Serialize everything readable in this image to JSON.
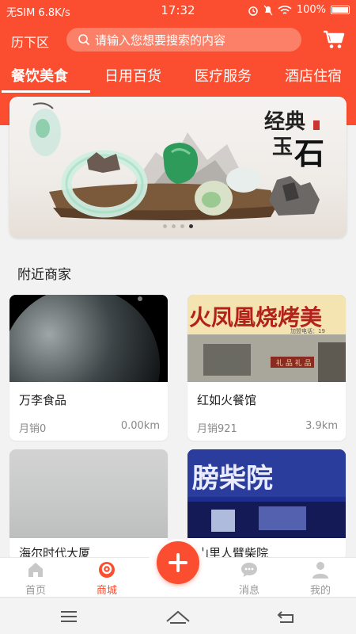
{
  "status_bar": {
    "carrier": "无SIM 6.8K/s",
    "time": "17:32",
    "battery": "100%"
  },
  "header": {
    "location": "历下区",
    "search_placeholder": "请输入您想要搜索的内容"
  },
  "tabs": [
    {
      "label": "餐饮美食",
      "active": true
    },
    {
      "label": "日用百货",
      "active": false
    },
    {
      "label": "医疗服务",
      "active": false
    },
    {
      "label": "酒店住宿",
      "active": false
    }
  ],
  "banner": {
    "slide_count": 4,
    "active_slide": 4
  },
  "section": {
    "title": "附近商家"
  },
  "merchants": [
    {
      "name": "万李食品",
      "sales": "月销0",
      "distance": "0.00km"
    },
    {
      "name": "红如火餐馆",
      "sales": "月销921",
      "distance": "3.9km"
    },
    {
      "name": "海尔时代大厦",
      "sales": "",
      "distance": ""
    },
    {
      "name": "山里人臂柴院",
      "sales": "",
      "distance": ""
    }
  ],
  "bottom_nav": {
    "items": [
      {
        "label": "首页",
        "icon": "home-icon",
        "active": false
      },
      {
        "label": "商城",
        "icon": "mall-icon",
        "active": true
      },
      {
        "label": "消息",
        "icon": "message-icon",
        "active": false
      },
      {
        "label": "我的",
        "icon": "profile-icon",
        "active": false
      }
    ]
  },
  "colors": {
    "brand": "#fb4d2f",
    "text": "#222222",
    "muted": "#888888"
  }
}
